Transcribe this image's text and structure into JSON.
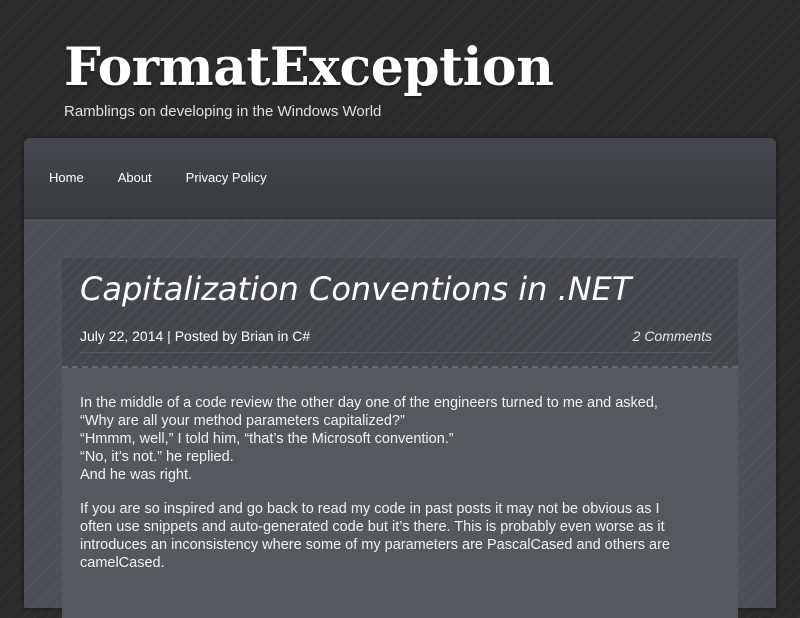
{
  "site": {
    "title": "FormatException",
    "tagline": "Ramblings on developing in the Windows World"
  },
  "nav": {
    "items": [
      {
        "label": "Home"
      },
      {
        "label": "About"
      },
      {
        "label": "Privacy Policy"
      }
    ]
  },
  "post": {
    "title": "Capitalization Conventions in .NET",
    "date": "July 22, 2014",
    "separator": " | Posted by ",
    "author": "Brian",
    "in_text": " in ",
    "category": "C#",
    "comments": "2 Comments",
    "paragraph1": {
      "line1": "In the middle of a code review the other day one of the engineers turned to me and asked,",
      "line2": "“Why are all your method parameters capitalized?”",
      "line3": "“Hmmm, well,” I told him, “that’s the Microsoft convention.”",
      "line4": "“No, it’s not.” he replied.",
      "line5": "And he was right."
    },
    "paragraph2": {
      "line1": "If you are so inspired and go back to read my code in past posts it may not be obvious as I",
      "line2": "often use snippets and auto-generated code but it’s there.  This is probably even worse as it",
      "line3": "introduces an inconsistency where some of my parameters are PascalCased and others are",
      "line4": "camelCased."
    }
  },
  "colors": {
    "page_background": "#2b2b2b",
    "nav_background": "#3f4145",
    "post_header_background": "#44464b",
    "post_body_background": "#56585d",
    "text": "#ffffff"
  }
}
